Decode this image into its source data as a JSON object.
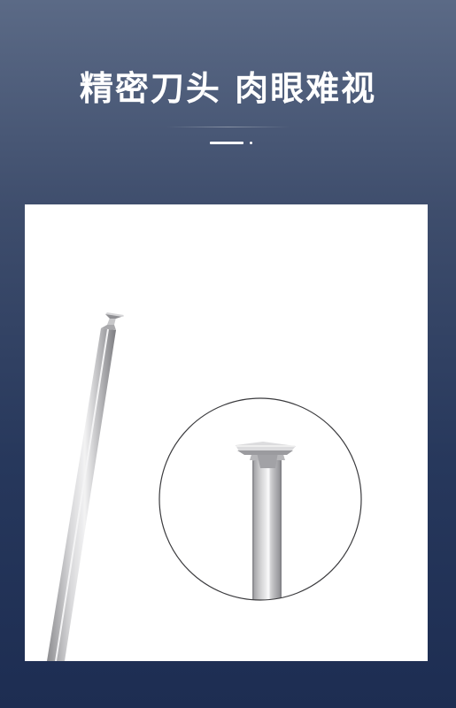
{
  "header": {
    "title": "精密刀头 肉眼难视"
  },
  "product_image": {
    "subject": "engraving-bit",
    "background_color": "#ffffff",
    "tool_color": "#b8b8bb"
  }
}
